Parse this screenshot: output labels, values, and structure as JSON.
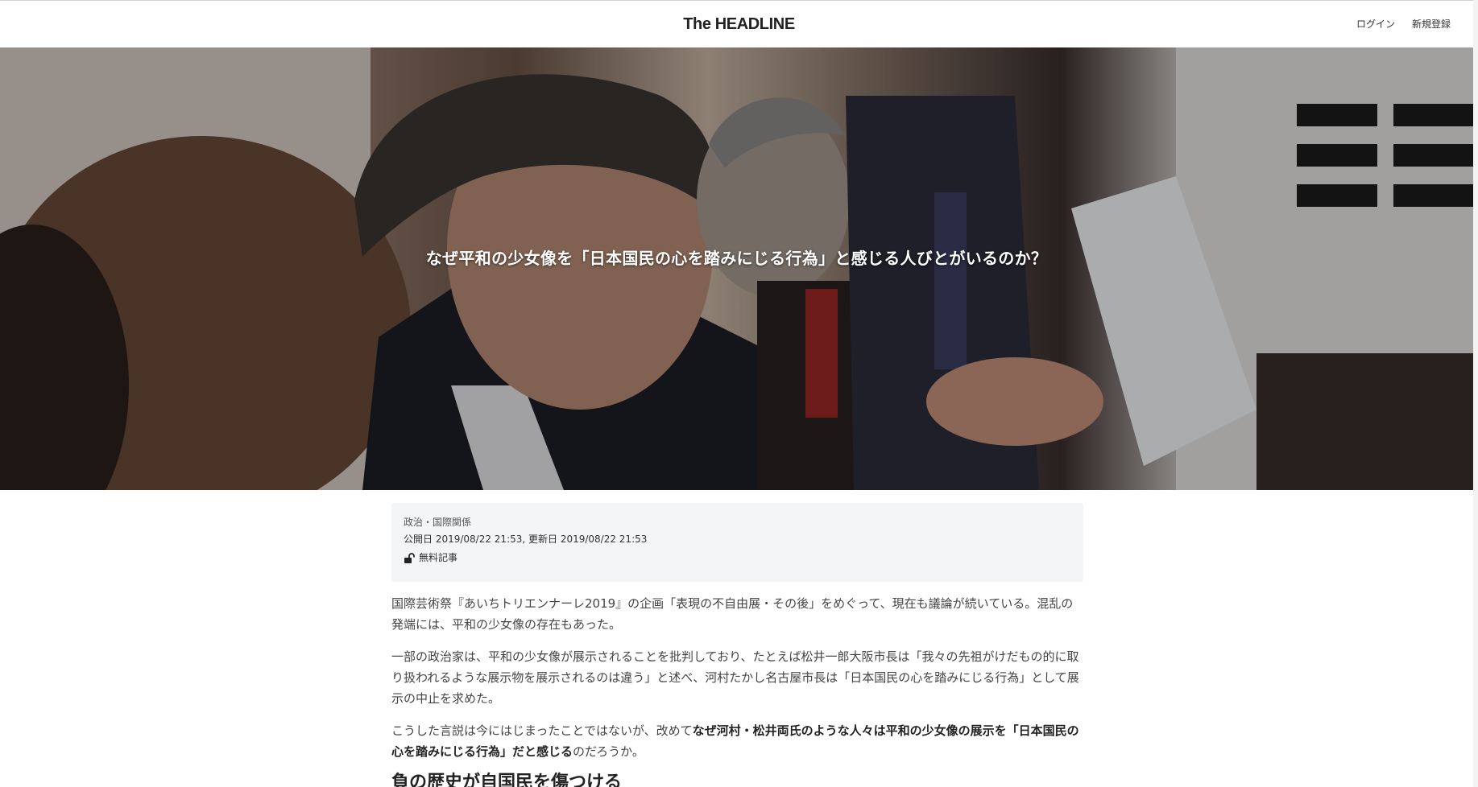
{
  "header": {
    "logo": "The HEADLINE",
    "login_label": "ログイン",
    "signup_label": "新規登録"
  },
  "hero": {
    "title": "なぜ平和の少女像を「日本国民の心を踏みにじる行為」と感じる人びとがいるのか？"
  },
  "meta": {
    "category": "政治・国際関係",
    "dates": "公開日 2019/08/22 21:53, 更新日 2019/08/22 21:53",
    "free_label": "無料記事"
  },
  "article": {
    "p1": "国際芸術祭『あいちトリエンナーレ2019』の企画「表現の不自由展・その後」をめぐって、現在も議論が続いている。混乱の発端には、平和の少女像の存在もあった。",
    "p2": "一部の政治家は、平和の少女像が展示されることを批判しており、たとえば松井一郎大阪市長は「我々の先祖がけだもの的に取り扱われるような展示物を展示されるのは違う」と述べ、河村たかし名古屋市長は「日本国民の心を踏みにじる行為」として展示の中止を求めた。",
    "p3_pre": "こうした言説は今にはじまったことではないが、改めて",
    "p3_bold": "なぜ河村・松井両氏のような人々は平和の少女像の展示を「日本国民の心を踏みにじる行為」だと感じる",
    "p3_post": "のだろうか。",
    "section_heading": "負の歴史が自国民を傷つける"
  },
  "colors": {
    "meta_card_bg": "#f4f5f7",
    "hero_overlay": "rgba(0,0,0,0.30)"
  },
  "icons": {
    "lock": "unlocked-padlock-icon"
  }
}
